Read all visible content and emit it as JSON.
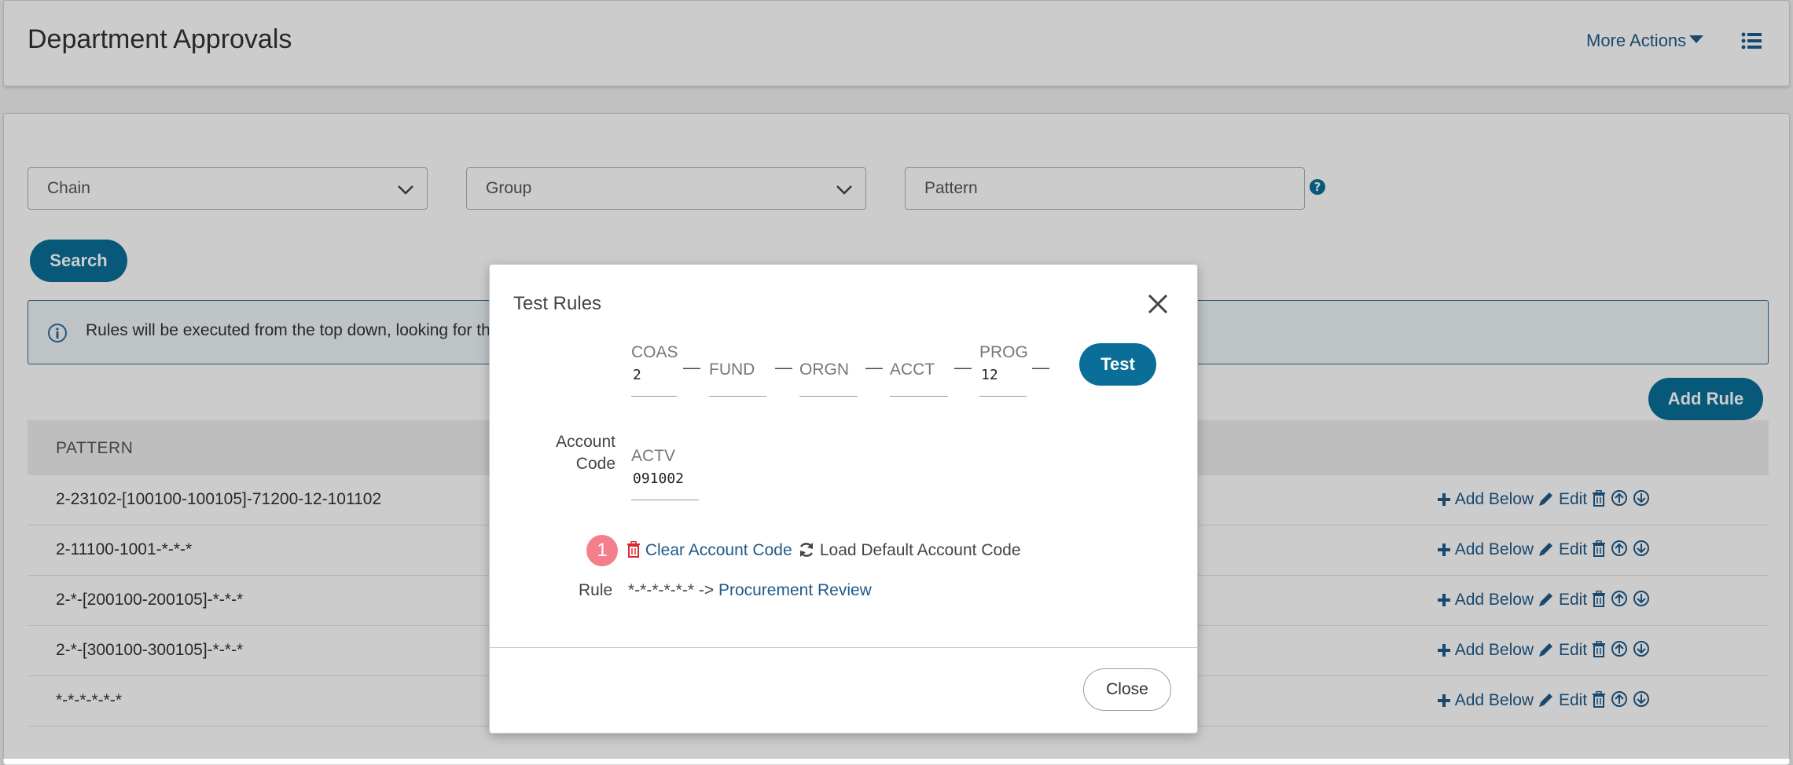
{
  "header": {
    "title": "Department Approvals",
    "more_actions_label": "More Actions"
  },
  "filters": {
    "chain_placeholder": "Chain",
    "group_placeholder": "Group",
    "pattern_placeholder": "Pattern",
    "search_label": "Search"
  },
  "info": {
    "text": "Rules will be executed from the top down, looking for th"
  },
  "add_rule_label": "Add Rule",
  "table": {
    "header_pattern": "PATTERN",
    "rows": [
      {
        "pattern": "2-23102-[100100-100105]-71200-12-101102"
      },
      {
        "pattern": "2-11100-1001-*-*-*"
      },
      {
        "pattern": "2-*-[200100-200105]-*-*-*"
      },
      {
        "pattern": "2-*-[300100-300105]-*-*-*"
      },
      {
        "pattern": "*-*-*-*-*-*"
      }
    ],
    "action_add_below": "Add Below",
    "action_edit": "Edit"
  },
  "modal": {
    "title": "Test Rules",
    "segments": [
      {
        "label": "COAS",
        "value": "2"
      },
      {
        "label": "FUND",
        "value": ""
      },
      {
        "label": "ORGN",
        "value": ""
      },
      {
        "label": "ACCT",
        "value": ""
      },
      {
        "label": "PROG",
        "value": "12"
      },
      {
        "label": "ACTV",
        "value": "091002"
      }
    ],
    "dash": "—",
    "test_label": "Test",
    "account_code_label_1": "Account",
    "account_code_label_2": "Code",
    "badge": "1",
    "clear_label": "Clear Account Code",
    "load_label": "Load Default Account Code",
    "rule_label": "Rule",
    "rule_pattern": "*-*-*-*-*-* ->",
    "rule_target": "Procurement Review",
    "close_label": "Close"
  },
  "colors": {
    "primary": "#0b6e99",
    "link": "#1f5a8a",
    "danger": "#d9282f",
    "badge": "#f47f8a"
  }
}
